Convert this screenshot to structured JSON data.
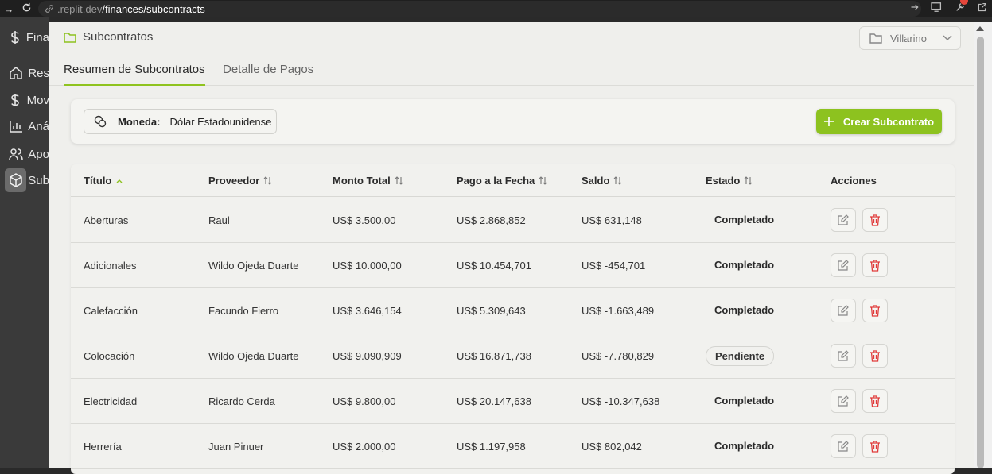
{
  "browser": {
    "url_host": ".replit.dev",
    "url_path": "/finances/subcontracts"
  },
  "sidebar": {
    "items": [
      {
        "label": "Fina",
        "icon": "dollar-icon"
      },
      {
        "label": "Res",
        "icon": "home-icon"
      },
      {
        "label": "Mov",
        "icon": "dollar-icon"
      },
      {
        "label": "Aná",
        "icon": "bar-chart-icon"
      },
      {
        "label": "Apo",
        "icon": "users-icon"
      },
      {
        "label": "Sub",
        "icon": "box-icon"
      }
    ]
  },
  "header": {
    "title": "Subcontratos",
    "project": "Villarino"
  },
  "tabs": [
    {
      "label": "Resumen de Subcontratos",
      "active": true
    },
    {
      "label": "Detalle de Pagos",
      "active": false
    }
  ],
  "toolbar": {
    "currency_label": "Moneda:",
    "currency_value": "Dólar Estadounidense",
    "create_label": "Crear Subcontrato"
  },
  "table": {
    "columns": [
      "Título",
      "Proveedor",
      "Monto Total",
      "Pago a la Fecha",
      "Saldo",
      "Estado",
      "Acciones"
    ],
    "rows": [
      {
        "titulo": "Aberturas",
        "proveedor": "Raul",
        "monto": "US$ 3.500,00",
        "pago": "US$ 2.868,852",
        "saldo": "US$ 631,148",
        "estado": "Completado"
      },
      {
        "titulo": "Adicionales",
        "proveedor": "Wildo Ojeda Duarte",
        "monto": "US$ 10.000,00",
        "pago": "US$ 10.454,701",
        "saldo": "US$ -454,701",
        "estado": "Completado"
      },
      {
        "titulo": "Calefacción",
        "proveedor": "Facundo Fierro",
        "monto": "US$ 3.646,154",
        "pago": "US$ 5.309,643",
        "saldo": "US$ -1.663,489",
        "estado": "Completado"
      },
      {
        "titulo": "Colocación",
        "proveedor": "Wildo Ojeda Duarte",
        "monto": "US$ 9.090,909",
        "pago": "US$ 16.871,738",
        "saldo": "US$ -7.780,829",
        "estado": "Pendiente"
      },
      {
        "titulo": "Electricidad",
        "proveedor": "Ricardo Cerda",
        "monto": "US$ 9.800,00",
        "pago": "US$ 20.147,638",
        "saldo": "US$ -10.347,638",
        "estado": "Completado"
      },
      {
        "titulo": "Herrería",
        "proveedor": "Juan Pinuer",
        "monto": "US$ 2.000,00",
        "pago": "US$ 1.197,958",
        "saldo": "US$ 802,042",
        "estado": "Completado"
      }
    ]
  },
  "colors": {
    "accent": "#8dc21f",
    "delete": "#e03a3a"
  }
}
